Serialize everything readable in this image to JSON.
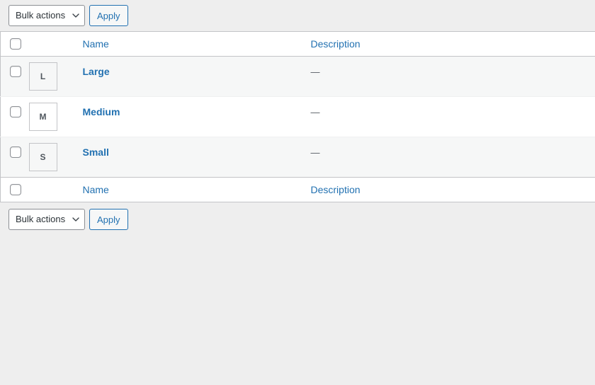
{
  "toolbar_top": {
    "bulk_actions_label": "Bulk actions",
    "apply_label": "Apply"
  },
  "toolbar_bottom": {
    "bulk_actions_label": "Bulk actions",
    "apply_label": "Apply"
  },
  "table": {
    "columns": {
      "checkbox": "",
      "thumbnail": "",
      "name": "Name",
      "description": "Description"
    },
    "rows": [
      {
        "thumb_letter": "L",
        "name": "Large",
        "description": "—"
      },
      {
        "thumb_letter": "M",
        "name": "Medium",
        "description": "—"
      },
      {
        "thumb_letter": "S",
        "name": "Small",
        "description": "—"
      }
    ]
  },
  "colors": {
    "page_background": "#eeeeee",
    "table_background": "#ffffff",
    "alternate_row": "#f6f7f7",
    "link_blue": "#2271b1",
    "border": "#c3c4c7",
    "text": "#3c434a"
  }
}
